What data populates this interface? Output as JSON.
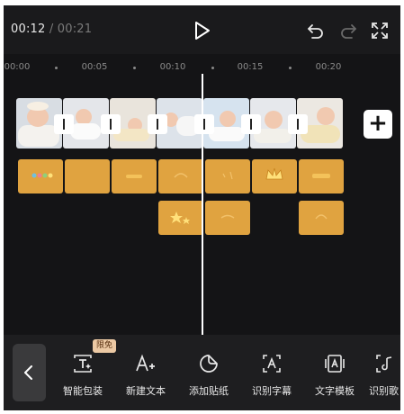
{
  "header": {
    "current_time": "00:12",
    "separator": "/",
    "total_time": "00:21"
  },
  "ruler": {
    "labels": [
      "00:00",
      "00:05",
      "00:10",
      "00:15",
      "00:20"
    ]
  },
  "timeline": {
    "video_clip_count": 7,
    "transition_count": 6,
    "sticker_row1_count": 7,
    "sticker_row2_count": 3
  },
  "toolbar": {
    "badge": "限免",
    "items": [
      {
        "label": "智能包装",
        "icon": "smart-pack-icon"
      },
      {
        "label": "新建文本",
        "icon": "new-text-icon"
      },
      {
        "label": "添加贴纸",
        "icon": "add-sticker-icon"
      },
      {
        "label": "识别字幕",
        "icon": "recognize-subtitle-icon"
      },
      {
        "label": "文字模板",
        "icon": "text-template-icon"
      },
      {
        "label": "识别歌",
        "icon": "recognize-lyrics-icon"
      }
    ]
  },
  "colors": {
    "background": "#141416",
    "sticker": "#e0a340",
    "accent": "#ffffff"
  }
}
